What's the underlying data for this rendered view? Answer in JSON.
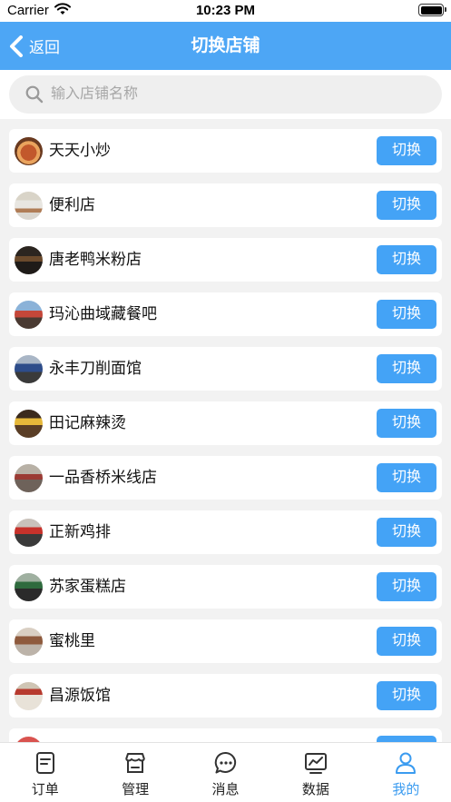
{
  "status_bar": {
    "carrier": "Carrier",
    "time": "10:23 PM"
  },
  "nav": {
    "back_label": "返回",
    "title": "切换店铺"
  },
  "search": {
    "placeholder": "输入店铺名称",
    "value": ""
  },
  "stores": [
    {
      "name": "天天小炒",
      "switch_label": "切换"
    },
    {
      "name": "便利店",
      "switch_label": "切换"
    },
    {
      "name": "唐老鸭米粉店",
      "switch_label": "切换"
    },
    {
      "name": "玛沁曲域藏餐吧",
      "switch_label": "切换"
    },
    {
      "name": "永丰刀削面馆",
      "switch_label": "切换"
    },
    {
      "name": "田记麻辣烫",
      "switch_label": "切换"
    },
    {
      "name": "一品香桥米线店",
      "switch_label": "切换"
    },
    {
      "name": "正新鸡排",
      "switch_label": "切换"
    },
    {
      "name": "苏家蛋糕店",
      "switch_label": "切换"
    },
    {
      "name": "蜜桃里",
      "switch_label": "切换"
    },
    {
      "name": "昌源饭馆",
      "switch_label": "切换"
    },
    {
      "name": "",
      "switch_label": ""
    }
  ],
  "tabs": [
    {
      "label": "订单",
      "icon": "order-icon",
      "active": false
    },
    {
      "label": "管理",
      "icon": "store-manage-icon",
      "active": false
    },
    {
      "label": "消息",
      "icon": "message-icon",
      "active": false
    },
    {
      "label": "数据",
      "icon": "data-chart-icon",
      "active": false
    },
    {
      "label": "我的",
      "icon": "profile-icon",
      "active": true
    }
  ],
  "colors": {
    "accent": "#4da6f5",
    "button": "#44a3f6",
    "active_tab": "#3a9bf0",
    "background": "#f2f2f2"
  }
}
